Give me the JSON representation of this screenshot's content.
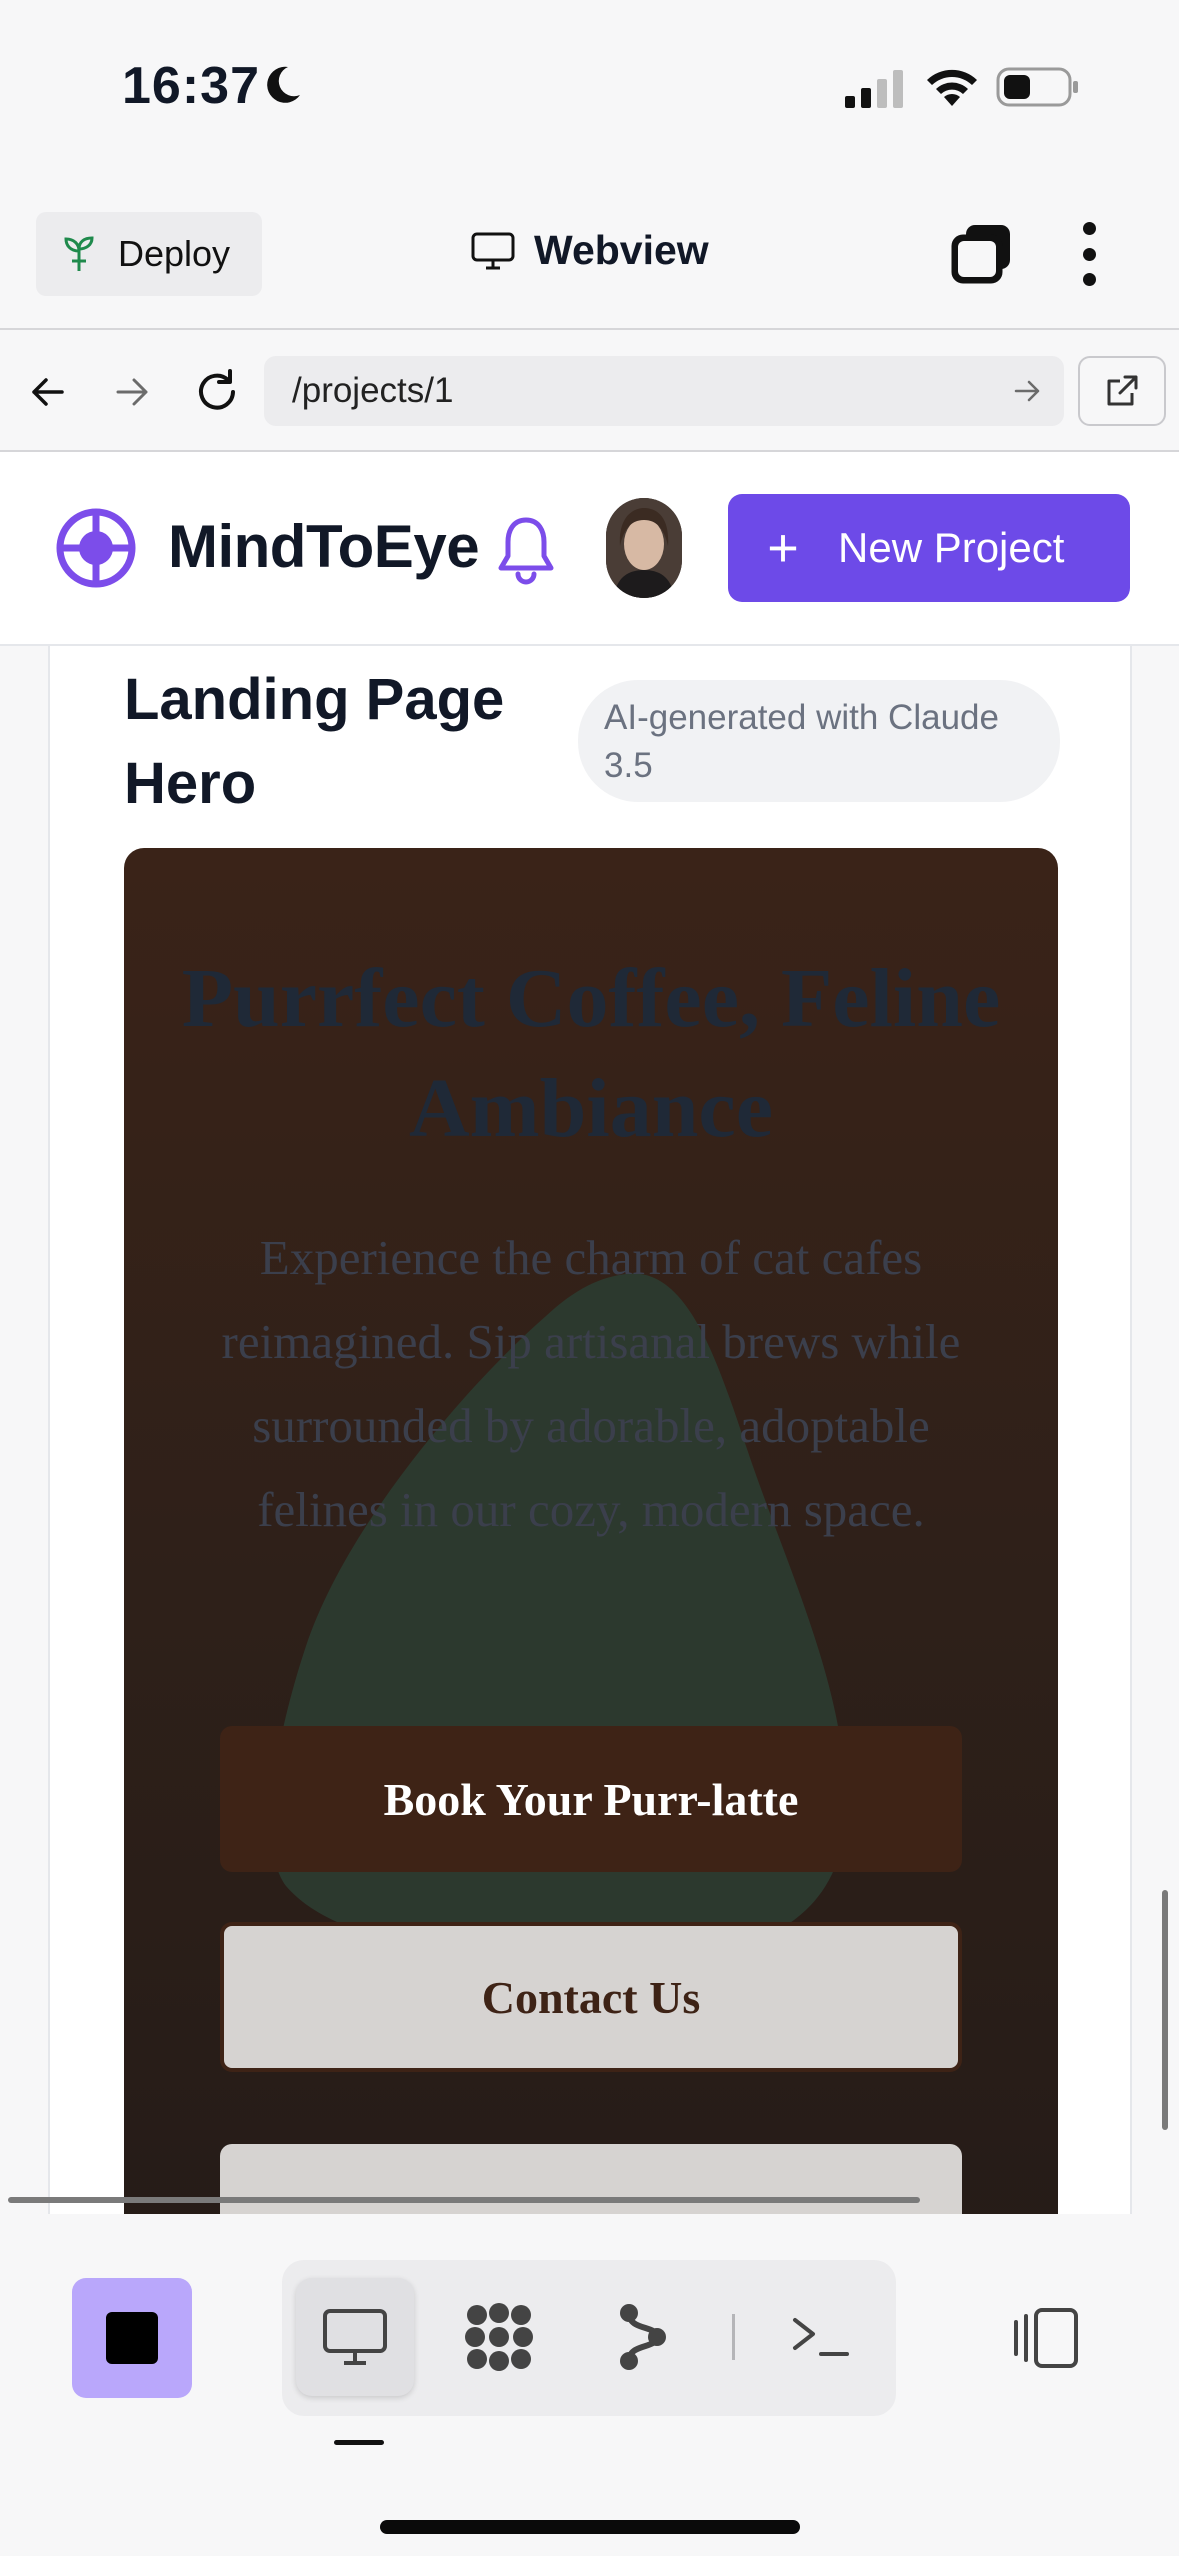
{
  "status_bar": {
    "time": "16:37"
  },
  "toolbar": {
    "deploy_label": "Deploy",
    "title": "Webview"
  },
  "url_bar": {
    "url": "/projects/1"
  },
  "header": {
    "brand": "MindToEye",
    "new_project_label": "New Project"
  },
  "project": {
    "title": "Landing Page Hero",
    "badge": "AI-generated with Claude 3.5"
  },
  "preview": {
    "heading": "Purrfect Coffee, Feline Ambiance",
    "paragraph": "Experience the charm of cat cafes reimagined. Sip artisanal brews while surrounded by adorable, adoptable felines in our cozy, modern space.",
    "primary_button": "Book Your Purr-latte",
    "secondary_button": "Contact Us"
  },
  "colors": {
    "accent": "#6d4ae8",
    "preview_bg": "#2e2019",
    "preview_primary": "#3e2316",
    "blob": "#2c3b2f",
    "stop_button": "#b9a7fb"
  },
  "icons": {
    "deploy": "sprout-icon",
    "webview": "monitor-icon",
    "tabs": "tabs-icon",
    "menu": "more-vertical-icon",
    "back": "arrow-left-icon",
    "forward": "arrow-right-icon",
    "reload": "reload-icon",
    "external": "external-link-icon",
    "logo": "crosshair-logo-icon",
    "notifications": "bell-icon",
    "bottom": [
      "stop-icon",
      "monitor-icon",
      "grid-dots-icon",
      "branch-icon",
      "terminal-icon",
      "panel-toggle-icon"
    ]
  }
}
